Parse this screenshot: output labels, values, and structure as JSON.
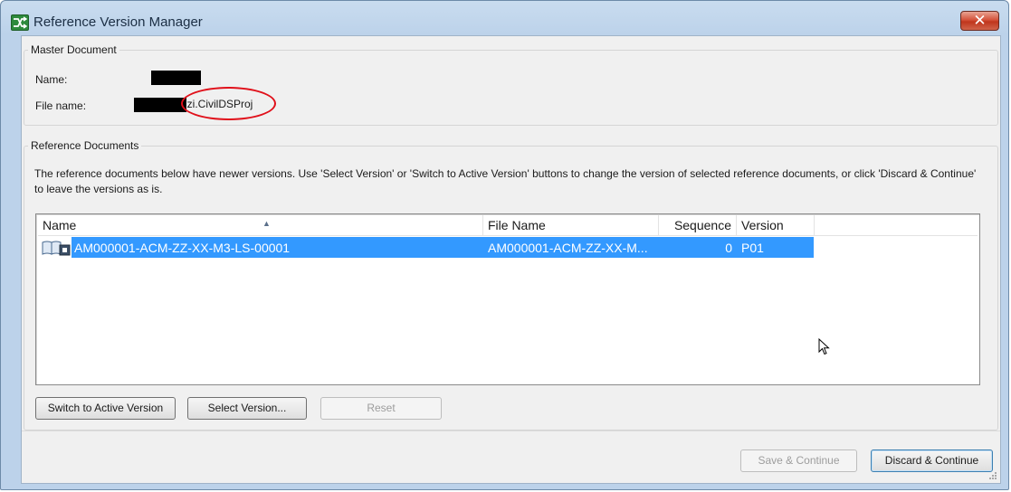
{
  "window": {
    "title": "Reference Version Manager",
    "close_label": "✕"
  },
  "master": {
    "group_label": "Master Document",
    "name_label": "Name:",
    "file_name_label": "File name:",
    "file_name_suffix": "izi.CivilDSProj"
  },
  "references": {
    "group_label": "Reference Documents",
    "description": "The reference documents below have newer versions. Use 'Select Version' or 'Switch to Active Version' buttons to change the version of selected reference documents, or click 'Discard & Continue' to leave the versions as is.",
    "columns": [
      "Name",
      "File Name",
      "Sequence",
      "Version"
    ],
    "rows": [
      {
        "name": "AM000001-ACM-ZZ-XX-M3-LS-00001",
        "file_name": "AM000001-ACM-ZZ-XX-M...",
        "sequence": "0",
        "version": "P01",
        "selected": true
      }
    ],
    "buttons": {
      "switch_active": "Switch to Active Version",
      "select_version": "Select Version...",
      "reset": "Reset"
    }
  },
  "footer": {
    "save_continue": "Save & Continue",
    "discard_continue": "Discard & Continue"
  },
  "colors": {
    "selection": "#3399ff",
    "highlight_ellipse": "#e0101a",
    "close_button": "#c0351c"
  }
}
